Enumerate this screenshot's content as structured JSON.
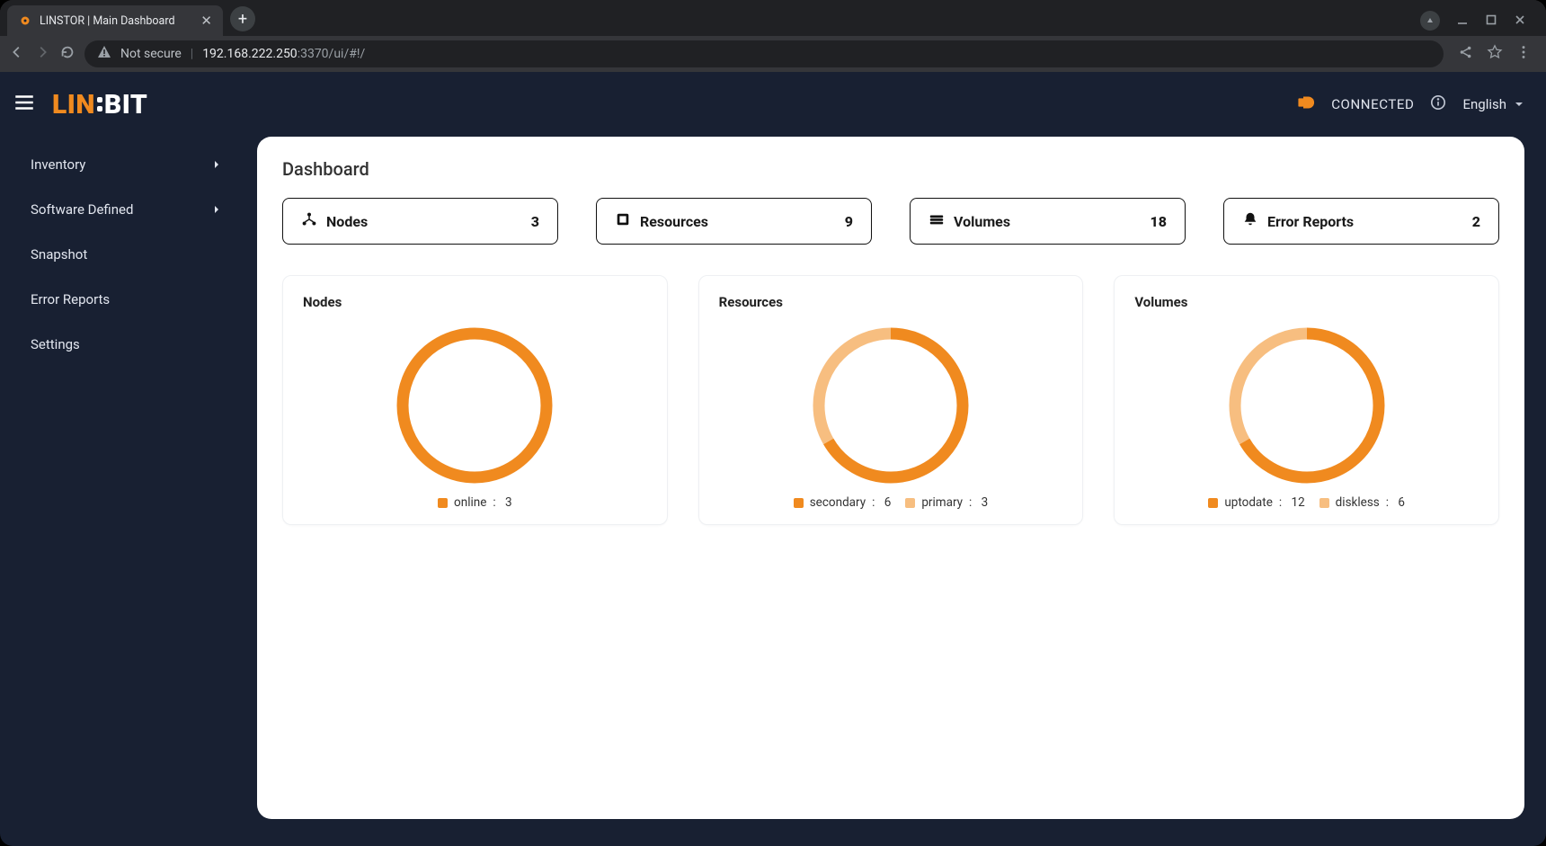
{
  "browser": {
    "tab_title": "LINSTOR | Main Dashboard",
    "not_secure_label": "Not secure",
    "url_host": "192.168.222.250",
    "url_rest": ":3370/ui/#!/"
  },
  "header": {
    "logo_lin": "LIN",
    "logo_bit": "BIT",
    "connection_status": "CONNECTED",
    "language": "English"
  },
  "sidebar": {
    "items": [
      {
        "label": "Inventory",
        "chevron": true
      },
      {
        "label": "Software Defined",
        "chevron": true
      },
      {
        "label": "Snapshot",
        "chevron": false
      },
      {
        "label": "Error Reports",
        "chevron": false
      },
      {
        "label": "Settings",
        "chevron": false
      }
    ]
  },
  "page": {
    "title": "Dashboard"
  },
  "stats": [
    {
      "icon": "nodes",
      "label": "Nodes",
      "value": "3"
    },
    {
      "icon": "resources",
      "label": "Resources",
      "value": "9"
    },
    {
      "icon": "volumes",
      "label": "Volumes",
      "value": "18"
    },
    {
      "icon": "bell",
      "label": "Error Reports",
      "value": "2"
    }
  ],
  "colors": {
    "primary": "#f08a1f",
    "primary_light": "#f7be80"
  },
  "charts": [
    {
      "title": "Nodes",
      "series": [
        {
          "name": "online",
          "value": 3
        }
      ]
    },
    {
      "title": "Resources",
      "series": [
        {
          "name": "secondary",
          "value": 6
        },
        {
          "name": "primary",
          "value": 3
        }
      ]
    },
    {
      "title": "Volumes",
      "series": [
        {
          "name": "uptodate",
          "value": 12
        },
        {
          "name": "diskless",
          "value": 6
        }
      ]
    }
  ],
  "chart_data": [
    {
      "type": "pie",
      "title": "Nodes",
      "categories": [
        "online"
      ],
      "values": [
        3
      ]
    },
    {
      "type": "pie",
      "title": "Resources",
      "categories": [
        "secondary",
        "primary"
      ],
      "values": [
        6,
        3
      ]
    },
    {
      "type": "pie",
      "title": "Volumes",
      "categories": [
        "uptodate",
        "diskless"
      ],
      "values": [
        12,
        6
      ]
    }
  ]
}
